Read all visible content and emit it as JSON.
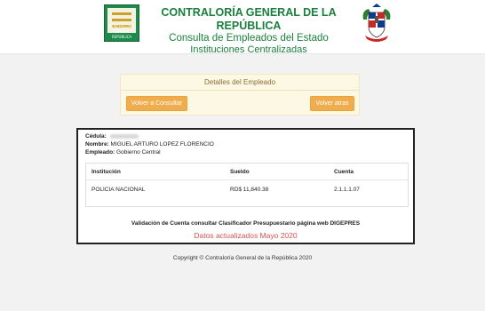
{
  "header": {
    "logo_text": "CONTRALORÍA GENERAL REPÚBLICA",
    "title_main": "CONTRALORÍA GENERAL DE LA REPÚBLICA",
    "title_sub": "Consulta de Empleados del Estado",
    "title_sub2": "Instituciones Centralizadas"
  },
  "details": {
    "title": "Detalles del Empleado",
    "consult_button": "Volver a Consultar",
    "back_button": "Volver atras"
  },
  "employee": {
    "cedula_label": "Cédula:",
    "nombre_label": "Nombre:",
    "nombre_value": "MIGUEL ARTURO LOPEZ FLORENCIO",
    "empleado_label": "Empleado:",
    "empleado_value": "Gobierno Central"
  },
  "table": {
    "headers": [
      "Institución",
      "Sueldo",
      "Cuenta"
    ],
    "row": [
      "POLICIA NACIONAL",
      "RD$ 11,840.38",
      "2.1.1.1.07"
    ]
  },
  "footer_box": {
    "validation": "Validación de Cuenta consultar Clasificador Presupuestario página web DIGEPRES",
    "updated": "Datos actualizados Mayo 2020"
  },
  "copyright": "Copyright © Contraloría General de la República 2020",
  "colors": {
    "brand_green": "#1a7f3c",
    "button_orange": "#f0ad4e",
    "alert_red": "#d9534f",
    "panel_yellow": "#fcf8e3"
  }
}
